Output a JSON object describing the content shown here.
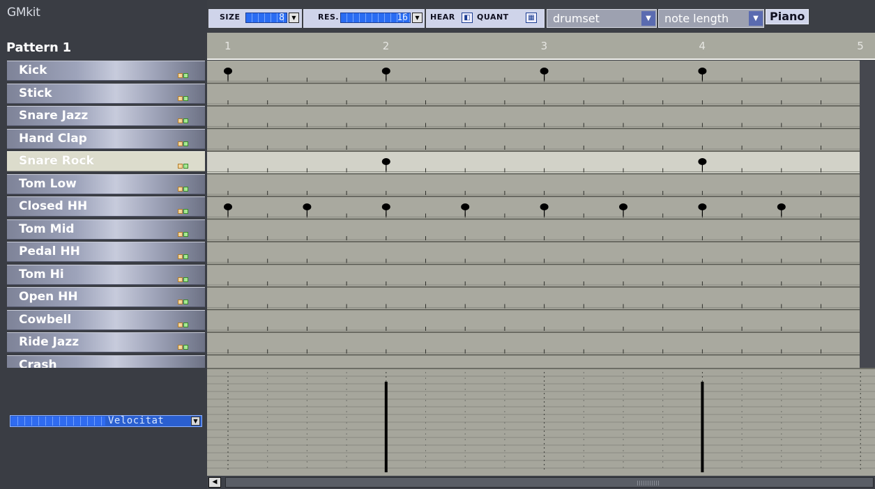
{
  "app": {
    "kit_name": "GMkit",
    "pattern_name": "Pattern 1"
  },
  "toolbar": {
    "size_label": "SIZE",
    "size_value": "8",
    "res_label": "RES.",
    "res_value": "16",
    "hear_label": "HEAR",
    "quant_label": "QUANT",
    "instrument_select": "drumset",
    "mode_select": "note length",
    "piano_label": "Piano"
  },
  "ruler": {
    "beats": [
      "1",
      "2",
      "3",
      "4",
      "5"
    ]
  },
  "tracks": [
    {
      "label": "Kick",
      "notes": [
        1,
        5,
        9,
        13
      ],
      "selected": false
    },
    {
      "label": "Stick",
      "notes": [],
      "selected": false
    },
    {
      "label": "Snare Jazz",
      "notes": [],
      "selected": false
    },
    {
      "label": "Hand Clap",
      "notes": [],
      "selected": false
    },
    {
      "label": "Snare Rock",
      "notes": [
        5,
        13
      ],
      "selected": true
    },
    {
      "label": "Tom Low",
      "notes": [],
      "selected": false
    },
    {
      "label": "Closed HH",
      "notes": [
        1,
        3,
        5,
        7,
        9,
        11,
        13,
        15
      ],
      "selected": false
    },
    {
      "label": "Tom Mid",
      "notes": [],
      "selected": false
    },
    {
      "label": "Pedal HH",
      "notes": [],
      "selected": false
    },
    {
      "label": "Tom Hi",
      "notes": [],
      "selected": false
    },
    {
      "label": "Open HH",
      "notes": [],
      "selected": false
    },
    {
      "label": "Cowbell",
      "notes": [],
      "selected": false
    },
    {
      "label": "Ride Jazz",
      "notes": [],
      "selected": false
    },
    {
      "label": "Crash",
      "notes": [],
      "selected": false
    }
  ],
  "velocity": {
    "selector_label": "Velocitat",
    "bars": [
      {
        "step": 5,
        "level": 0.95
      },
      {
        "step": 13,
        "level": 0.95
      }
    ]
  },
  "grid_info": {
    "steps": 16,
    "beats": 4
  },
  "colors": {
    "grid_bg": "#a9a99f",
    "row_selected": "#d2d2c8",
    "note": "#000000",
    "field_blue": "#2a6cf2"
  }
}
